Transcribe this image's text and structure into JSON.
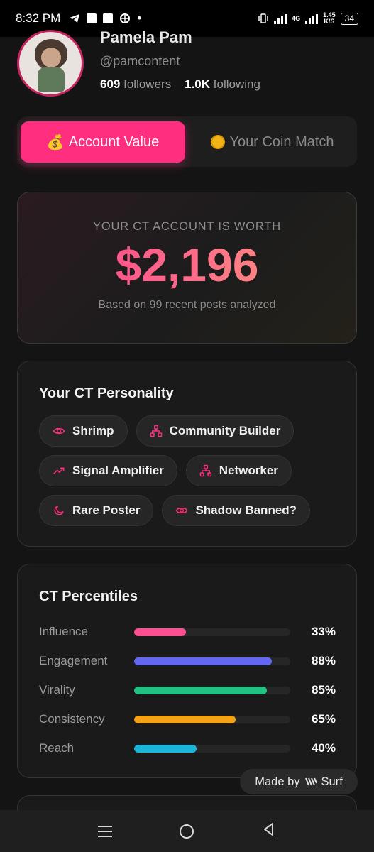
{
  "status_bar": {
    "time": "8:32 PM",
    "network": "4G",
    "speed_value": "1.45",
    "speed_unit": "K/S",
    "battery": "34"
  },
  "profile": {
    "name": "Pamela Pam",
    "handle": "@pamcontent",
    "followers_count": "609",
    "followers_label": "followers",
    "following_count": "1.0K",
    "following_label": "following"
  },
  "tabs": [
    {
      "label": "Account Value",
      "icon": "money-bag-icon",
      "active": true
    },
    {
      "label": "Your Coin Match",
      "icon": "coin-icon",
      "active": false
    }
  ],
  "account_value": {
    "label": "YOUR CT ACCOUNT IS WORTH",
    "value": "$2,196",
    "subtext": "Based on 99 recent posts analyzed"
  },
  "personality": {
    "title": "Your CT Personality",
    "traits": [
      {
        "label": "Shrimp",
        "icon": "eye-icon"
      },
      {
        "label": "Community Builder",
        "icon": "network-icon"
      },
      {
        "label": "Signal Amplifier",
        "icon": "trending-up-icon"
      },
      {
        "label": "Networker",
        "icon": "network-icon"
      },
      {
        "label": "Rare Poster",
        "icon": "moon-icon"
      },
      {
        "label": "Shadow Banned?",
        "icon": "eye-icon"
      }
    ]
  },
  "percentiles": {
    "title": "CT Percentiles",
    "rows": [
      {
        "label": "Influence",
        "value": "33%",
        "fraction": 0.33,
        "color": "#ff4f93"
      },
      {
        "label": "Engagement",
        "value": "88%",
        "fraction": 0.88,
        "color": "#6467f2"
      },
      {
        "label": "Virality",
        "value": "85%",
        "fraction": 0.85,
        "color": "#22c083"
      },
      {
        "label": "Consistency",
        "value": "65%",
        "fraction": 0.65,
        "color": "#f5a316"
      },
      {
        "label": "Reach",
        "value": "40%",
        "fraction": 0.4,
        "color": "#1bb7d8"
      }
    ]
  },
  "made_by": {
    "prefix": "Made by",
    "brand": "Surf",
    "icon": "surf-logo-icon"
  },
  "colors": {
    "accent": "#ff2e7e",
    "background": "#141414",
    "card": "#1a1a1a"
  }
}
